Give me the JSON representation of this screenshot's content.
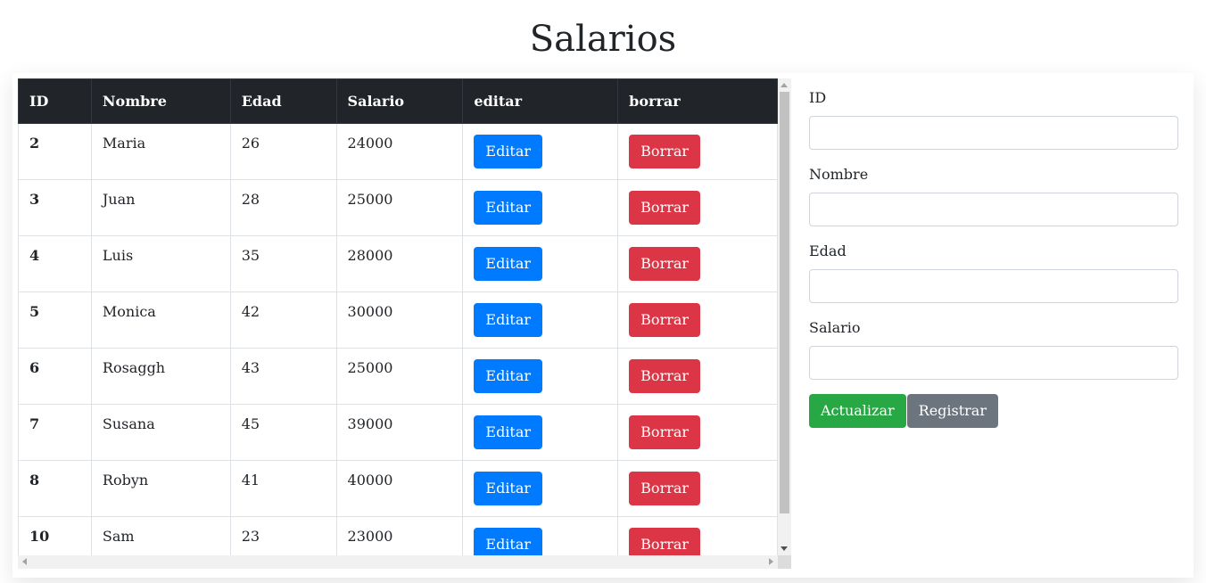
{
  "page": {
    "title": "Salarios"
  },
  "table": {
    "columns": [
      "ID",
      "Nombre",
      "Edad",
      "Salario",
      "editar",
      "borrar"
    ],
    "rows": [
      {
        "id": "2",
        "nombre": "Maria",
        "edad": "26",
        "salario": "24000"
      },
      {
        "id": "3",
        "nombre": "Juan",
        "edad": "28",
        "salario": "25000"
      },
      {
        "id": "4",
        "nombre": "Luis",
        "edad": "35",
        "salario": "28000"
      },
      {
        "id": "5",
        "nombre": "Monica",
        "edad": "42",
        "salario": "30000"
      },
      {
        "id": "6",
        "nombre": "Rosaggh",
        "edad": "43",
        "salario": "25000"
      },
      {
        "id": "7",
        "nombre": "Susana",
        "edad": "45",
        "salario": "39000"
      },
      {
        "id": "8",
        "nombre": "Robyn",
        "edad": "41",
        "salario": "40000"
      },
      {
        "id": "10",
        "nombre": "Sam",
        "edad": "23",
        "salario": "23000"
      }
    ],
    "edit_label": "Editar",
    "delete_label": "Borrar"
  },
  "form": {
    "fields": [
      {
        "label": "ID",
        "value": "",
        "placeholder": ""
      },
      {
        "label": "Nombre",
        "value": "",
        "placeholder": ""
      },
      {
        "label": "Edad",
        "value": "",
        "placeholder": ""
      },
      {
        "label": "Salario",
        "value": "",
        "placeholder": ""
      }
    ],
    "update_label": "Actualizar",
    "register_label": "Registrar"
  },
  "colors": {
    "header_bg": "#212529",
    "primary": "#007bff",
    "danger": "#dc3545",
    "success": "#28a745",
    "secondary": "#6c757d"
  }
}
